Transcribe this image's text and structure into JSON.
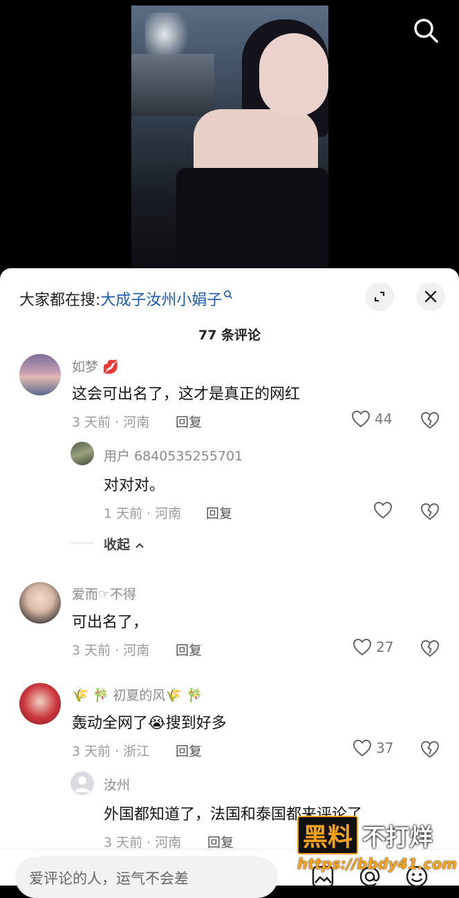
{
  "sheet": {
    "trend_prefix": "大家都在搜:",
    "trend_keyword": "大成子汝州小娟子",
    "comment_count": "77 条评论"
  },
  "comments": [
    {
      "username": "如梦",
      "username_emoji": "💋",
      "text": "这会可出名了，这才是真正的网红",
      "meta": "3 天前 · 河南",
      "reply_label": "回复",
      "likes": "44"
    },
    {
      "username": "用户 6840535255701",
      "text": "对对对。",
      "meta": "1 天前 · 河南",
      "reply_label": "回复"
    },
    {
      "username": "爱而☞不得",
      "text": "可出名了，",
      "meta": "3 天前 · 河南",
      "reply_label": "回复",
      "likes": "27"
    },
    {
      "username_prefix": "🌾 🎋",
      "username": "初夏的风",
      "username_suffix": "🌾 🎋",
      "text_before": "轰动全网了",
      "text_emoji": "😭",
      "text_after": "搜到好多",
      "meta": "3 天前 · 浙江",
      "reply_label": "回复",
      "likes": "37"
    },
    {
      "username": "汝州",
      "text": "外国都知道了，法国和泰国都来评论了",
      "meta": "3 天前 · 河南",
      "reply_label": "回复"
    }
  ],
  "collapse_label": "收起",
  "input": {
    "placeholder": "爱评论的人，运气不会差"
  },
  "watermark": {
    "boxed": "黑料",
    "text": "不打烊",
    "url": "https://bbdy41.com"
  },
  "icons": [
    "search-icon",
    "expand-icon",
    "close-icon",
    "heart-icon",
    "heart-broken-icon",
    "image-icon",
    "at-icon",
    "emoji-icon"
  ]
}
